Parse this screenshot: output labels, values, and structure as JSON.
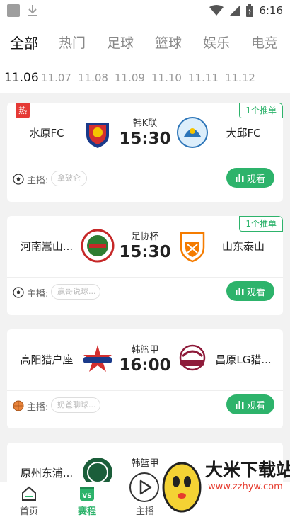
{
  "status_bar": {
    "time": "6:16"
  },
  "category_tabs": [
    "全部",
    "热门",
    "足球",
    "篮球",
    "娱乐",
    "电竞"
  ],
  "dates": [
    "11.06",
    "11.07",
    "11.08",
    "11.09",
    "11.10",
    "11.11",
    "11.12"
  ],
  "matches": [
    {
      "hot_badge": "热",
      "tip_badge": "1个推单",
      "home": "水原FC",
      "away": "大邱FC",
      "league": "韩K联",
      "time": "15:30",
      "host_label": "主播:",
      "host_name": "拿破仑",
      "watch_label": "观看",
      "sport_icon": "soccer-ball-icon"
    },
    {
      "tip_badge": "1个推单",
      "home": "河南嵩山...",
      "away": "山东泰山",
      "league": "足协杯",
      "time": "15:30",
      "host_label": "主播:",
      "host_name": "赢哥说球...",
      "watch_label": "观看",
      "sport_icon": "soccer-ball-icon"
    },
    {
      "home": "高阳猎户座",
      "away": "昌原LG猎...",
      "league": "韩篮甲",
      "time": "16:00",
      "host_label": "主播:",
      "host_name": "奶爸聊球...",
      "watch_label": "观看",
      "sport_icon": "basketball-icon"
    },
    {
      "home": "原州东浦...",
      "league": "韩篮甲"
    }
  ],
  "bottom_nav": {
    "home": "首页",
    "schedule": "赛程",
    "anchor": "主播"
  },
  "watermark": {
    "text": "大米下载站",
    "url": "www.zzhyw.com"
  },
  "colors": {
    "accent": "#2db36b",
    "hot": "#e53935"
  }
}
